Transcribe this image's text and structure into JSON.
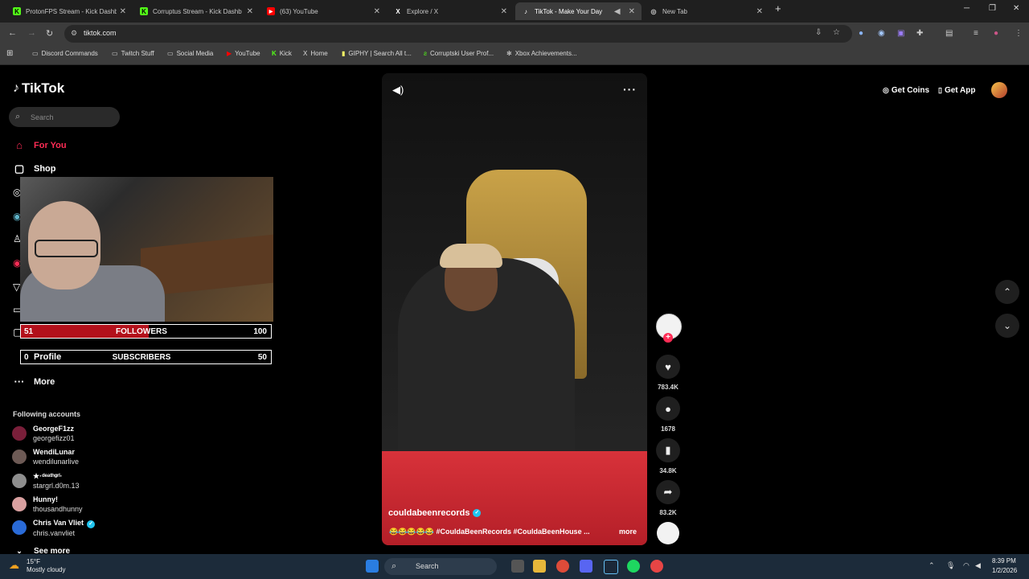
{
  "browser": {
    "tabs": [
      {
        "title": "ProtonFPS Stream - Kick Dashb",
        "icon": "K",
        "color": "#53fc18"
      },
      {
        "title": "Corruptus Stream - Kick Dashb",
        "icon": "K",
        "color": "#53fc18"
      },
      {
        "title": "(63) YouTube",
        "icon": "▶",
        "color": "#ff0000"
      },
      {
        "title": "Explore / X",
        "icon": "X",
        "color": "#ffffff"
      },
      {
        "title": "TikTok - Make Your Day",
        "icon": "♪",
        "color": "#ffffff"
      },
      {
        "title": "New Tab",
        "icon": "◎",
        "color": "#cccccc"
      }
    ],
    "new_tab": "+",
    "url": "tiktok.com",
    "bookmarks": [
      {
        "label": "Discord Commands",
        "icon": "▭"
      },
      {
        "label": "Twitch Stuff",
        "icon": "▭"
      },
      {
        "label": "Social Media",
        "icon": "▭"
      },
      {
        "label": "YouTube",
        "icon": "▶"
      },
      {
        "label": "Kick",
        "icon": "K"
      },
      {
        "label": "Home",
        "icon": "X"
      },
      {
        "label": "GIPHY | Search All t...",
        "icon": "▮"
      },
      {
        "label": "Corruptski User Prof...",
        "icon": "ƨ"
      },
      {
        "label": "Xbox Achievements...",
        "icon": "✻"
      }
    ]
  },
  "tiktok": {
    "logo": "TikTok",
    "search_placeholder": "Search",
    "nav": [
      {
        "label": "For You",
        "icon": "⌂"
      },
      {
        "label": "Shop",
        "icon": "🛍"
      },
      {
        "label": "Profile",
        "icon": "●"
      },
      {
        "label": "More",
        "icon": "···"
      }
    ],
    "following_title": "Following accounts",
    "following": [
      {
        "name": "GeorgeF1zz",
        "handle": "georgefizz01",
        "color": "#7a1f3a"
      },
      {
        "name": "WendiLunar",
        "handle": "wendilunarlive",
        "color": "#6d5a55"
      },
      {
        "name": "★·ᵈᵉᵃᵗʰᵍʳˡ·",
        "handle": "stargrl.d0m.13",
        "color": "#8e8e8e"
      },
      {
        "name": "Hunny!",
        "handle": "thousandhunny",
        "color": "#d9a0a0"
      },
      {
        "name": "Chris Van Vliet",
        "handle": "chris.vanvliet",
        "color": "#2a6bd8",
        "verified": true
      }
    ],
    "see_more": "See more",
    "top_right": {
      "coins": "Get Coins",
      "app": "Get App"
    },
    "video": {
      "author": "couldabeenrecords",
      "caption": "😂😂😂😂😂 #CouldaBeenRecords #CouldaBeenHouse ...",
      "more": "more",
      "likes": "783.4K",
      "comments": "1678",
      "saves": "34.8K",
      "shares": "83.2K"
    }
  },
  "stream_overlay": {
    "followers": {
      "current": "51",
      "label": "FOLLOWERS",
      "goal": "100",
      "progress": 0.51
    },
    "subscribers": {
      "current": "0",
      "label": "SUBSCRIBERS",
      "goal": "50",
      "progress": 0.0
    }
  },
  "taskbar": {
    "weather_temp": "15°F",
    "weather_cond": "Mostly cloudy",
    "search": "Search",
    "time": "8:39 PM",
    "date": "1/2/2026"
  }
}
